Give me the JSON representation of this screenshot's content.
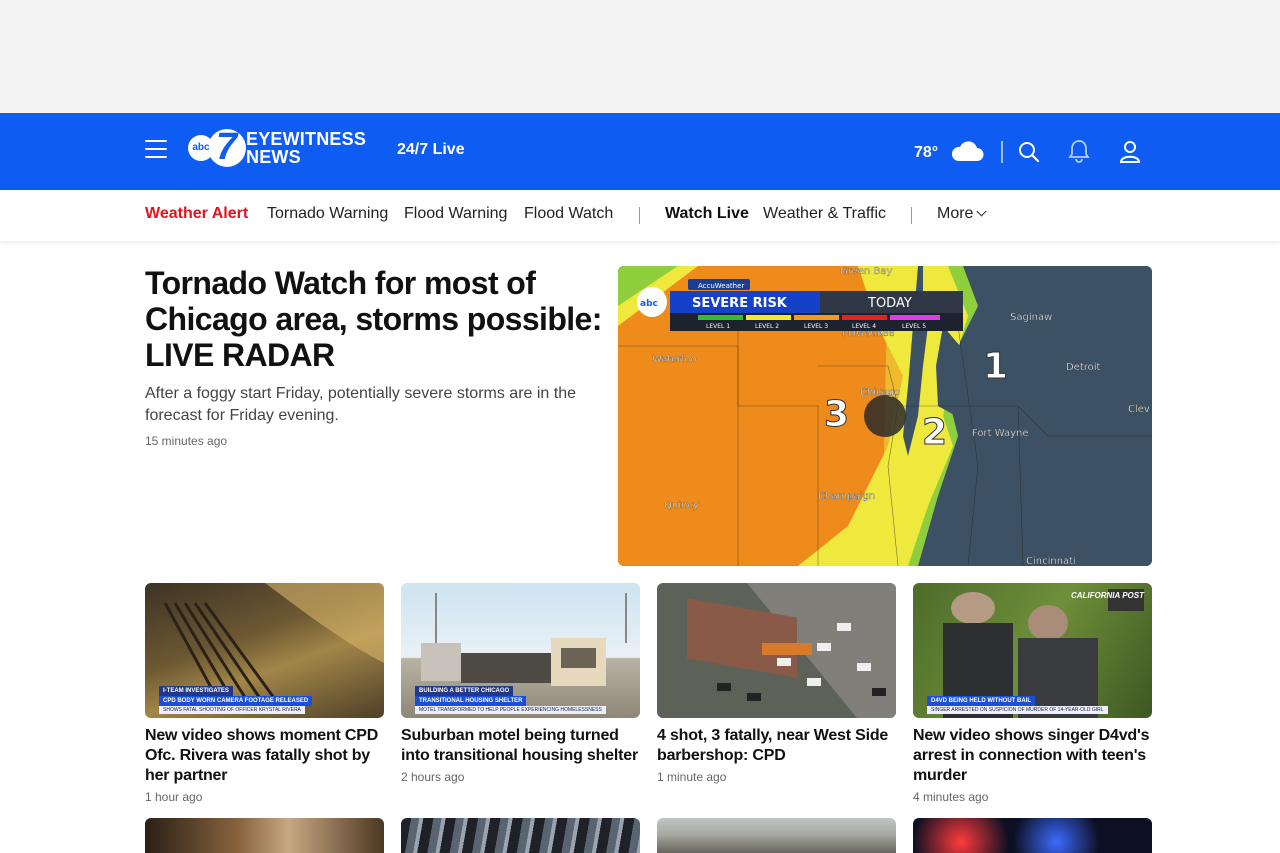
{
  "header": {
    "logo_abc": "abc",
    "logo_seven": "7",
    "logo_line1": "EYEWITNESS",
    "logo_line2": "NEWS",
    "live_label": "24/7 Live",
    "temperature": "78°",
    "weather_icon": "cloud-icon",
    "brand_color": "#0f5cf3"
  },
  "subnav": {
    "alert": "Weather Alert",
    "items": [
      "Tornado Warning",
      "Flood Warning",
      "Flood Watch"
    ],
    "watch_live": "Watch Live",
    "weather_traffic": "Weather & Traffic",
    "more": "More"
  },
  "lead": {
    "title": "Tornado Watch for most of Chicago area, storms possible: LIVE RADAR",
    "dek": "After a foggy start Friday, potentially severe storms are in the forecast for Friday evening.",
    "time": "15 minutes ago",
    "map": {
      "brand": "AccuWeather",
      "banner": "SEVERE RISK",
      "day": "TODAY",
      "levels": [
        "LEVEL 1",
        "LEVEL 2",
        "LEVEL 3",
        "LEVEL 4",
        "LEVEL 5"
      ],
      "cities": [
        "Green Bay",
        "Saginaw",
        "Milwaukee",
        "Waterloo",
        "Detroit",
        "Chicago",
        "Clev",
        "Fort Wayne",
        "Quincy",
        "Champaign",
        "Cincinnati"
      ],
      "risk_numbers": [
        "1",
        "2",
        "3"
      ]
    }
  },
  "cards": [
    {
      "title": "New video shows moment CPD Ofc. Rivera was fatally shot by her partner",
      "time": "1 hour ago",
      "lower_third": "CPD BODY WORN CAMERA FOOTAGE RELEASED",
      "lower_sub": "SHOWS FATAL SHOOTING OF OFFICER KRYSTAL RIVERA",
      "tag": "I-TEAM INVESTIGATES"
    },
    {
      "title": "Suburban motel being turned into transitional housing shelter",
      "time": "2 hours ago",
      "lower_third": "TRANSITIONAL HOUSING SHELTER",
      "lower_sub": "MOTEL TRANSFORMED TO HELP PEOPLE EXPERIENCING HOMELESSNESS",
      "tag": "BUILDING A BETTER CHICAGO"
    },
    {
      "title": "4 shot, 3 fatally, near West Side barbershop: CPD",
      "time": "1 minute ago"
    },
    {
      "title": "New video shows singer D4vd's arrest in connection with teen's murder",
      "time": "4 minutes ago",
      "lower_third": "D4VD BEING HELD WITHOUT BAIL",
      "lower_sub": "SINGER ARRESTED ON SUSPICION OF MURDER OF 14-YEAR-OLD GIRL",
      "tag": "CALIFORNIA POST"
    }
  ]
}
